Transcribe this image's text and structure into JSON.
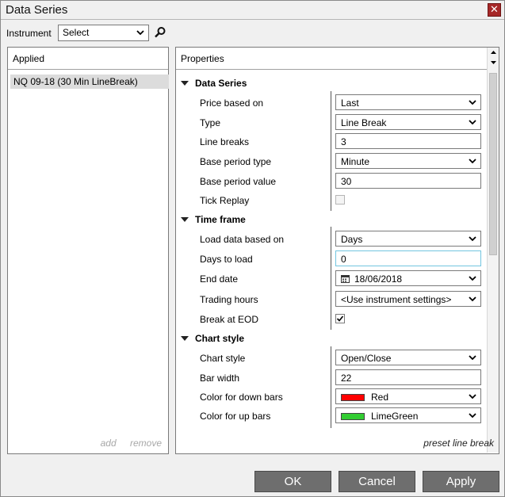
{
  "window": {
    "title": "Data Series"
  },
  "instrument": {
    "label": "Instrument",
    "value": "Select"
  },
  "applied": {
    "header": "Applied",
    "items": [
      "NQ 09-18 (30 Min LineBreak)"
    ],
    "add_label": "add",
    "remove_label": "remove"
  },
  "properties": {
    "header": "Properties",
    "categories": {
      "data_series": "Data Series",
      "time_frame": "Time frame",
      "chart_style": "Chart style"
    },
    "rows": {
      "price_based_on": {
        "label": "Price based on",
        "value": "Last"
      },
      "type": {
        "label": "Type",
        "value": "Line Break"
      },
      "line_breaks": {
        "label": "Line breaks",
        "value": "3"
      },
      "base_period_type": {
        "label": "Base period type",
        "value": "Minute"
      },
      "base_period_value": {
        "label": "Base period value",
        "value": "30"
      },
      "tick_replay": {
        "label": "Tick Replay",
        "checked": false
      },
      "load_data_based_on": {
        "label": "Load data based on",
        "value": "Days"
      },
      "days_to_load": {
        "label": "Days to load",
        "value": "0"
      },
      "end_date": {
        "label": "End date",
        "value": "18/06/2018"
      },
      "trading_hours": {
        "label": "Trading hours",
        "value": "<Use instrument settings>"
      },
      "break_at_eod": {
        "label": "Break at EOD",
        "checked": true
      },
      "chart_style": {
        "label": "Chart style",
        "value": "Open/Close"
      },
      "bar_width": {
        "label": "Bar width",
        "value": "22"
      },
      "color_down": {
        "label": "Color for down bars",
        "value": "Red",
        "color": "#ff0000"
      },
      "color_up": {
        "label": "Color for up bars",
        "value": "LimeGreen",
        "color": "#32cd32"
      }
    },
    "preset_label": "preset line break"
  },
  "buttons": {
    "ok": "OK",
    "cancel": "Cancel",
    "apply": "Apply"
  },
  "colors": {
    "button_bg": "#6e6e6e",
    "close_bg": "#a62828",
    "focus_border": "#72c5e0"
  }
}
